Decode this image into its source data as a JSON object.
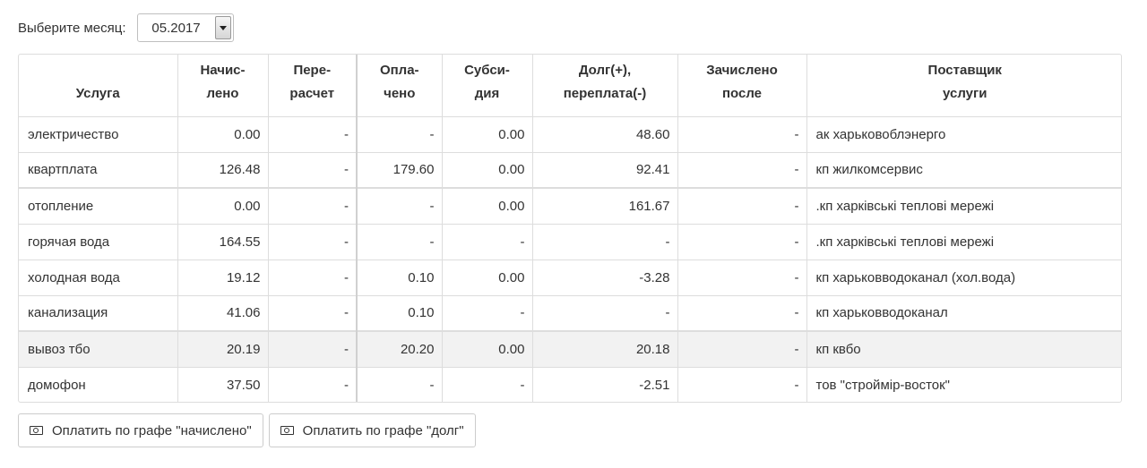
{
  "month": {
    "label": "Выберите месяц:",
    "value": "05.2017"
  },
  "table": {
    "headers": [
      {
        "line1": "",
        "line2": "Услуга"
      },
      {
        "line1": "Начис-",
        "line2": "лено"
      },
      {
        "line1": "Пере-",
        "line2": "расчет"
      },
      {
        "line1": "Опла-",
        "line2": "чено"
      },
      {
        "line1": "Субси-",
        "line2": "дия"
      },
      {
        "line1": "Долг(+),",
        "line2": "переплата(-)"
      },
      {
        "line1": "Зачислено",
        "line2": "после"
      },
      {
        "line1": "Поставщик",
        "line2": "услуги"
      }
    ],
    "rows": [
      [
        "электричество",
        "0.00",
        "-",
        "-",
        "0.00",
        "48.60",
        "-",
        "ак харьковоблэнерго"
      ],
      [
        "квартплата",
        "126.48",
        "-",
        "179.60",
        "0.00",
        "92.41",
        "-",
        "кп жилкомсервис"
      ],
      [
        "отопление",
        "0.00",
        "-",
        "-",
        "0.00",
        "161.67",
        "-",
        ".кп харківські теплові мережі"
      ],
      [
        "горячая вода",
        "164.55",
        "-",
        "-",
        "-",
        "-",
        "-",
        ".кп харківські теплові мережі"
      ],
      [
        "холодная вода",
        "19.12",
        "-",
        "0.10",
        "0.00",
        "-3.28",
        "-",
        "кп харьковводоканал (хол.вода)"
      ],
      [
        "канализация",
        "41.06",
        "-",
        "0.10",
        "-",
        "-",
        "-",
        "кп харьковводоканал"
      ],
      [
        "вывоз тбо",
        "20.19",
        "-",
        "20.20",
        "0.00",
        "20.18",
        "-",
        "кп квбо"
      ],
      [
        "домофон",
        "37.50",
        "-",
        "-",
        "-",
        "-2.51",
        "-",
        "тов \"строймір-восток\""
      ]
    ]
  },
  "buttons": {
    "pay_accrued": "Оплатить по графе \"начислено\"",
    "pay_debt": "Оплатить по графе \"долг\""
  }
}
